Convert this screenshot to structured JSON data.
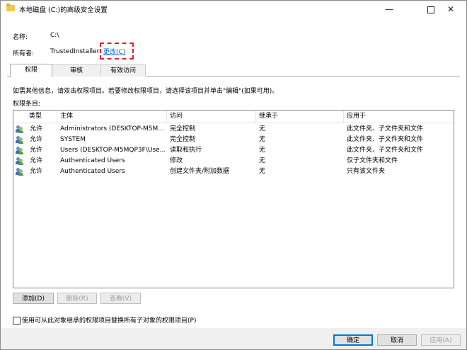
{
  "window": {
    "title": "本地磁盘 (C:)的高级安全设置",
    "minimize": "—",
    "close": "✕"
  },
  "info": {
    "name_label": "名称:",
    "name_value": "C:\\",
    "owner_label": "所有者:",
    "owner_value": "TrustedInstaller",
    "change_link": "更改(C)"
  },
  "tabs": [
    {
      "label": "权限",
      "active": true
    },
    {
      "label": "审核",
      "active": false
    },
    {
      "label": "有效访问",
      "active": false
    }
  ],
  "hint": "如需其他信息，请双击权限项目。若要修改权限项目，请选择该项目并单击\"编辑\"(如果可用)。",
  "entries_label": "权限条目:",
  "columns": [
    "类型",
    "主体",
    "访问",
    "继承于",
    "应用于"
  ],
  "rows": [
    {
      "type": "允许",
      "principal": "Administrators (DESKTOP-M5M...",
      "access": "完全控制",
      "inherited": "无",
      "applies": "此文件夹、子文件夹和文件"
    },
    {
      "type": "允许",
      "principal": "SYSTEM",
      "access": "完全控制",
      "inherited": "无",
      "applies": "此文件夹、子文件夹和文件"
    },
    {
      "type": "允许",
      "principal": "Users (DESKTOP-M5MQP3F\\Use...",
      "access": "读取和执行",
      "inherited": "无",
      "applies": "此文件夹、子文件夹和文件"
    },
    {
      "type": "允许",
      "principal": "Authenticated Users",
      "access": "修改",
      "inherited": "无",
      "applies": "仅子文件夹和文件"
    },
    {
      "type": "允许",
      "principal": "Authenticated Users",
      "access": "创建文件夹/附加数据",
      "inherited": "无",
      "applies": "只有该文件夹"
    }
  ],
  "actions": {
    "add": "添加(D)",
    "remove": "删除(R)",
    "view": "查看(V)"
  },
  "replace_checkbox_label": "使用可从此对象继承的权限项目替换所有子对象的权限项目(P)",
  "dialog_buttons": {
    "ok": "确定",
    "cancel": "取消",
    "apply": "应用(A)"
  }
}
